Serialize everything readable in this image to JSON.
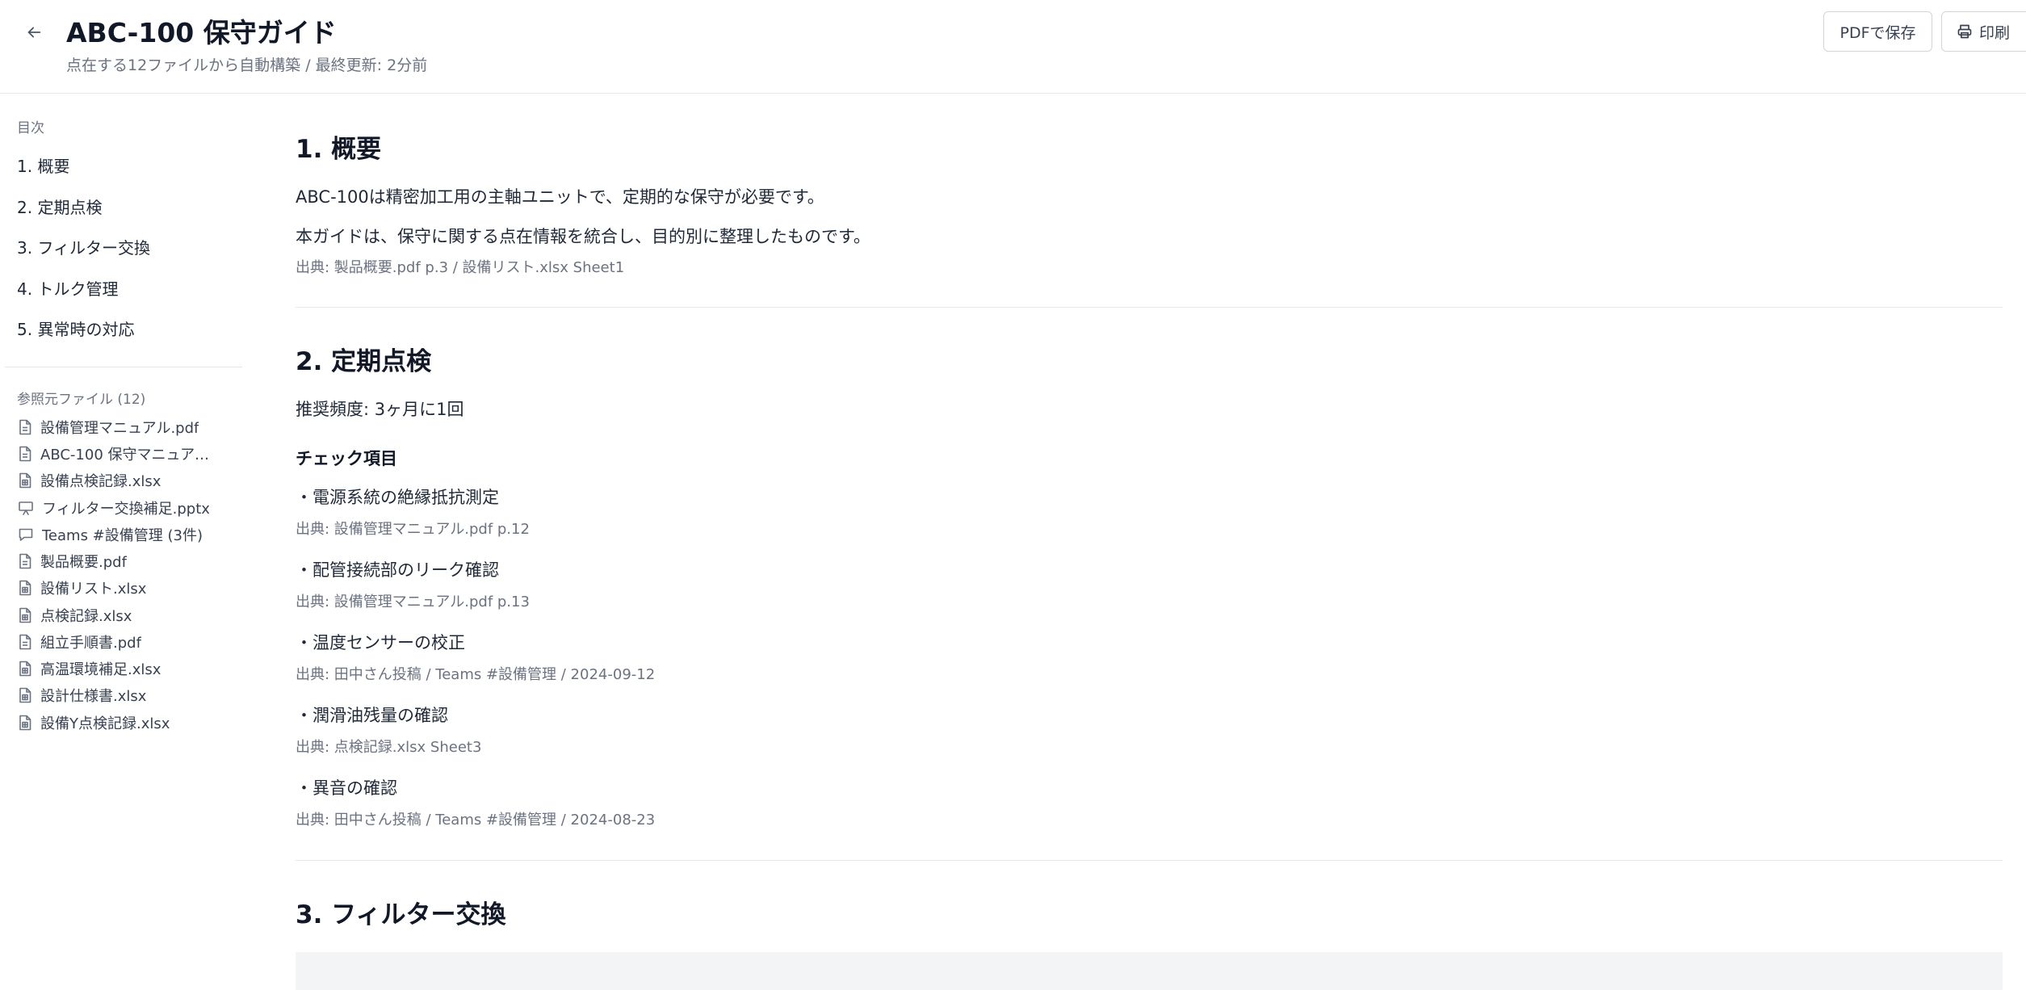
{
  "header": {
    "title": "ABC-100 保守ガイド",
    "subtitle": "点在する12ファイルから自動構築 / 最終更新: 2分前",
    "pdf_button": "PDFで保存",
    "print_button": "印刷"
  },
  "sidebar": {
    "toc_heading": "目次",
    "toc": [
      "1. 概要",
      "2. 定期点検",
      "3. フィルター交換",
      "4. トルク管理",
      "5. 異常時の対応"
    ],
    "files_heading": "参照元ファイル (12)",
    "files": [
      {
        "name": "設備管理マニュアル.pdf",
        "icon": "document-icon"
      },
      {
        "name": "ABC-100 保守マニュアル.pdf",
        "icon": "document-icon"
      },
      {
        "name": "設備点検記録.xlsx",
        "icon": "spreadsheet-icon"
      },
      {
        "name": "フィルター交換補足.pptx",
        "icon": "presentation-icon"
      },
      {
        "name": "Teams #設備管理 (3件)",
        "icon": "chat-icon"
      },
      {
        "name": "製品概要.pdf",
        "icon": "document-icon"
      },
      {
        "name": "設備リスト.xlsx",
        "icon": "spreadsheet-icon"
      },
      {
        "name": "点検記録.xlsx",
        "icon": "spreadsheet-icon"
      },
      {
        "name": "組立手順書.pdf",
        "icon": "document-icon"
      },
      {
        "name": "高温環境補足.xlsx",
        "icon": "spreadsheet-icon"
      },
      {
        "name": "設計仕様書.xlsx",
        "icon": "spreadsheet-icon"
      },
      {
        "name": "設備Y点検記録.xlsx",
        "icon": "spreadsheet-icon"
      }
    ]
  },
  "content": {
    "s1": {
      "title": "1. 概要",
      "p1": "ABC-100は精密加工用の主軸ユニットで、定期的な保守が必要です。",
      "p2": "本ガイドは、保守に関する点在情報を統合し、目的別に整理したものです。",
      "source": "出典: 製品概要.pdf p.3 / 設備リスト.xlsx Sheet1"
    },
    "s2": {
      "title": "2. 定期点検",
      "frequency": "推奨頻度: 3ヶ月に1回",
      "checklist_heading": "チェック項目",
      "items": [
        {
          "text": "・電源系統の絶縁抵抗測定",
          "source": "出典: 設備管理マニュアル.pdf p.12"
        },
        {
          "text": "・配管接続部のリーク確認",
          "source": "出典: 設備管理マニュアル.pdf p.13"
        },
        {
          "text": "・温度センサーの校正",
          "source": "出典: 田中さん投稿 / Teams #設備管理 / 2024-09-12"
        },
        {
          "text": "・潤滑油残量の確認",
          "source": "出典: 点検記録.xlsx Sheet3"
        },
        {
          "text": "・異音の確認",
          "source": "出典: 田中さん投稿 / Teams #設備管理 / 2024-08-23"
        }
      ]
    },
    "s3": {
      "title": "3. フィルター交換"
    }
  },
  "colors": {
    "text": "#1f2937",
    "muted": "#6b7280",
    "border": "#e5e7eb",
    "block_bg": "#f3f4f6"
  }
}
